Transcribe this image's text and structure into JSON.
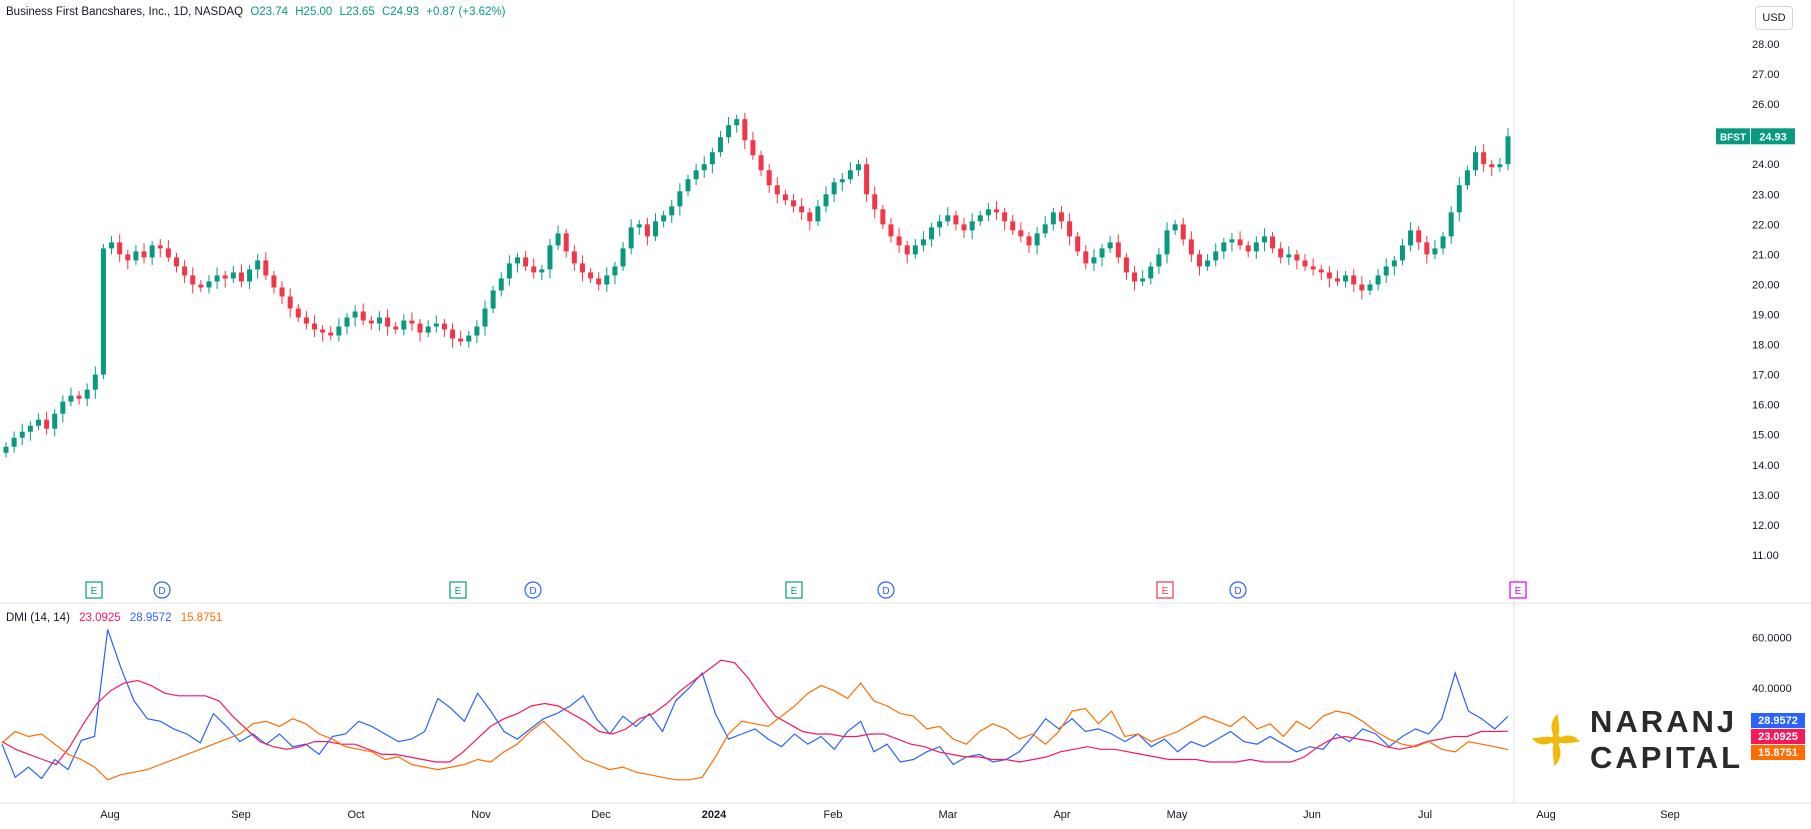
{
  "header": {
    "name": "Business First Bancshares, Inc., 1D, NASDAQ",
    "open": "O23.74",
    "high": "H25.00",
    "low": "L23.65",
    "close": "C24.93",
    "change": "+0.87 (+3.62%)"
  },
  "currency": "USD",
  "price_badge": {
    "symbol": "BFST",
    "value": "24.93"
  },
  "dmi": {
    "label": "DMI (14, 14)",
    "adx": "23.0925",
    "plus_di": "28.9572",
    "minus_di": "15.8751"
  },
  "brand": {
    "line1": "NARANJ",
    "line2": "CAPITAL"
  },
  "colors": {
    "up": "#089981",
    "down": "#f23645",
    "plus_di": "#2962ff",
    "adx": "#f7185b",
    "minus_di": "#ff6d00"
  },
  "chart_data": [
    {
      "type": "candlestick",
      "ylim": [
        10.0,
        28.6
      ],
      "y_ticks": [
        "28.00",
        "27.00",
        "26.00",
        "25.00",
        "24.00",
        "23.00",
        "22.00",
        "21.00",
        "20.00",
        "19.00",
        "18.00",
        "17.00",
        "16.00",
        "15.00",
        "14.00",
        "13.00",
        "12.00",
        "11.00"
      ],
      "x_labels": [
        "Aug",
        "Sep",
        "Oct",
        "Nov",
        "Dec",
        "2024",
        "Feb",
        "Mar",
        "Apr",
        "May",
        "Jun",
        "Jul",
        "Aug",
        "Sep"
      ],
      "closes": [
        14.6,
        14.9,
        15.1,
        15.3,
        15.5,
        15.2,
        15.7,
        16.1,
        16.3,
        16.2,
        16.5,
        17.0,
        21.2,
        21.4,
        21.0,
        20.8,
        21.1,
        20.9,
        21.3,
        21.2,
        20.9,
        20.6,
        20.3,
        20.0,
        19.9,
        20.1,
        20.3,
        20.2,
        20.4,
        20.1,
        20.5,
        20.8,
        20.3,
        19.9,
        19.6,
        19.2,
        18.9,
        18.7,
        18.5,
        18.4,
        18.3,
        18.6,
        18.9,
        19.1,
        18.8,
        18.7,
        18.9,
        18.6,
        18.5,
        18.8,
        18.7,
        18.4,
        18.6,
        18.7,
        18.5,
        18.2,
        18.1,
        18.3,
        18.6,
        19.2,
        19.8,
        20.2,
        20.7,
        20.9,
        20.6,
        20.4,
        20.5,
        21.3,
        21.7,
        21.1,
        20.7,
        20.4,
        20.2,
        20.0,
        20.3,
        20.6,
        21.2,
        21.9,
        22.0,
        21.6,
        22.1,
        22.3,
        22.6,
        23.1,
        23.5,
        23.8,
        24.0,
        24.4,
        24.9,
        25.3,
        25.5,
        24.8,
        24.3,
        23.8,
        23.3,
        23.0,
        22.8,
        22.6,
        22.4,
        22.1,
        22.6,
        23.0,
        23.4,
        23.5,
        23.8,
        24.0,
        23.0,
        22.5,
        22.0,
        21.6,
        21.3,
        21.0,
        21.3,
        21.5,
        21.9,
        22.1,
        22.3,
        22.0,
        21.8,
        22.1,
        22.3,
        22.5,
        22.4,
        22.1,
        21.8,
        21.6,
        21.3,
        21.7,
        22.0,
        22.4,
        22.1,
        21.6,
        21.1,
        20.7,
        20.9,
        21.2,
        21.4,
        20.9,
        20.4,
        20.1,
        20.2,
        20.6,
        21.0,
        21.8,
        22.0,
        21.5,
        21.0,
        20.6,
        20.8,
        21.1,
        21.4,
        21.5,
        21.3,
        21.1,
        21.4,
        21.6,
        21.2,
        20.9,
        21.0,
        20.8,
        20.6,
        20.5,
        20.4,
        20.2,
        20.1,
        20.3,
        20.0,
        19.8,
        20.0,
        20.3,
        20.6,
        20.8,
        21.3,
        21.8,
        21.4,
        21.0,
        21.2,
        21.6,
        22.4,
        23.3,
        23.8,
        24.4,
        24.0,
        23.9,
        24.0,
        24.93
      ],
      "series": [
        {
          "name": "",
          "values": [
            18.0,
            5.0,
            9.0,
            4.5,
            12.0,
            8.0,
            19.5,
            21.0,
            63.0,
            48.0,
            35.0,
            28.0,
            27.0,
            24.0,
            22.0,
            18.5,
            30.0,
            25.0,
            19.0,
            22.0,
            18.0,
            22.0,
            17.0,
            18.0,
            14.0,
            21.0,
            22.0,
            27.0,
            25.0,
            22.0,
            19.0,
            20.0,
            23.0,
            36.0,
            32.0,
            27.0,
            38.0,
            31.0,
            23.0,
            20.0,
            24.0,
            28.0,
            30.0,
            33.0,
            37.0,
            28.0,
            22.0,
            29.0,
            25.0,
            30.0,
            23.0,
            35.0,
            40.0,
            46.0,
            30.0,
            20.0,
            22.0,
            24.0,
            20.0,
            17.0,
            22.0,
            18.0,
            21.0,
            16.0,
            23.0,
            27.0,
            15.0,
            18.0,
            11.0,
            12.0,
            15.0,
            17.0,
            10.0,
            13.0,
            14.0,
            11.0,
            12.0,
            15.0,
            21.0,
            28.0,
            24.0,
            28.0,
            23.0,
            24.0,
            22.0,
            19.0,
            22.0,
            17.0,
            20.0,
            15.0,
            19.0,
            17.0,
            20.0,
            23.0,
            19.0,
            18.0,
            21.0,
            18.0,
            15.0,
            17.0,
            16.0,
            22.0,
            19.0,
            24.0,
            22.0,
            17.0,
            21.0,
            24.0,
            22.0,
            28.0,
            46.0,
            31.0,
            28.0,
            24.0,
            28.9572
          ]
        },
        {
          "name": "",
          "values": [
            19.0,
            16.0,
            14.0,
            12.0,
            10.0,
            17.0,
            26.0,
            34.0,
            39.0,
            42.0,
            43.0,
            41.0,
            38.0,
            37.0,
            37.0,
            37.0,
            35.0,
            29.0,
            24.0,
            19.0,
            17.0,
            16.0,
            17.0,
            19.0,
            19.0,
            18.0,
            18.0,
            16.0,
            14.0,
            14.0,
            13.0,
            12.0,
            11.0,
            11.0,
            15.0,
            20.0,
            25.0,
            28.0,
            30.0,
            33.0,
            34.0,
            33.0,
            30.0,
            27.0,
            23.0,
            22.0,
            24.0,
            28.0,
            30.0,
            34.0,
            39.0,
            43.0,
            47.0,
            51.0,
            50.0,
            44.0,
            36.0,
            29.0,
            26.0,
            23.0,
            22.0,
            22.0,
            21.0,
            21.0,
            22.0,
            22.0,
            20.0,
            18.0,
            17.0,
            15.0,
            14.0,
            13.0,
            13.0,
            12.0,
            12.0,
            11.0,
            12.0,
            13.0,
            15.0,
            16.0,
            17.0,
            16.0,
            16.0,
            15.0,
            14.0,
            13.0,
            12.0,
            12.0,
            12.0,
            11.0,
            11.0,
            11.0,
            12.0,
            11.0,
            11.0,
            11.0,
            13.0,
            17.0,
            20.0,
            21.0,
            20.0,
            19.0,
            17.0,
            16.0,
            17.0,
            19.0,
            20.0,
            21.0,
            21.0,
            23.0,
            23.0,
            23.0925
          ]
        },
        {
          "name": "",
          "values": [
            18.5,
            23.0,
            21.0,
            22.0,
            18.0,
            14.0,
            12.0,
            9.0,
            4.0,
            6.0,
            7.0,
            8.0,
            10.0,
            12.0,
            14.0,
            16.0,
            18.0,
            20.0,
            22.0,
            26.0,
            27.0,
            25.0,
            28.0,
            26.0,
            22.0,
            20.0,
            17.0,
            16.0,
            15.0,
            12.0,
            13.0,
            10.0,
            9.0,
            8.0,
            9.0,
            10.0,
            12.0,
            11.0,
            15.0,
            18.0,
            23.0,
            27.0,
            22.0,
            17.0,
            12.0,
            10.0,
            8.0,
            9.0,
            7.0,
            6.0,
            5.0,
            4.0,
            4.0,
            5.0,
            13.0,
            22.0,
            27.0,
            26.0,
            25.0,
            29.0,
            33.0,
            38.0,
            41.0,
            39.0,
            36.0,
            42.0,
            35.0,
            33.0,
            30.0,
            29.0,
            24.0,
            25.0,
            20.0,
            18.0,
            23.0,
            26.0,
            24.0,
            20.0,
            22.0,
            18.0,
            23.0,
            31.0,
            32.0,
            26.0,
            31.0,
            21.0,
            22.0,
            19.0,
            21.0,
            23.0,
            26.0,
            29.0,
            27.0,
            25.0,
            29.0,
            24.0,
            26.0,
            21.0,
            27.0,
            24.0,
            29.0,
            31.0,
            30.0,
            27.0,
            23.0,
            20.0,
            18.0,
            17.0,
            19.0,
            16.0,
            15.0,
            19.0,
            18.0,
            17.0,
            15.8751
          ]
        }
      ],
      "ylim_indicator": [
        0,
        66
      ],
      "indicator_ticks": [
        "60.0000",
        "40.0000"
      ]
    }
  ]
}
